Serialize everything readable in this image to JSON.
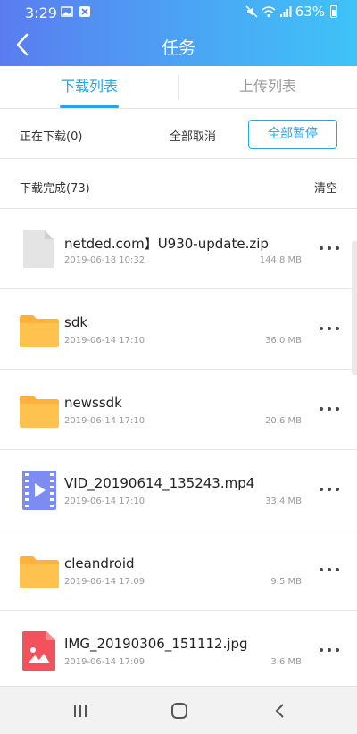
{
  "status_bar": {
    "time": "3:29",
    "battery": "63%"
  },
  "header": {
    "title": "任务"
  },
  "tabs": [
    {
      "label": "下载列表",
      "active": true
    },
    {
      "label": "上传列表",
      "active": false
    }
  ],
  "downloading": {
    "label": "正在下载(0)",
    "cancel_all": "全部取消",
    "pause_all": "全部暂停"
  },
  "completed": {
    "label": "下载完成(73)",
    "clear": "清空"
  },
  "files": [
    {
      "name": "netded.com】U930-update.zip",
      "date": "2019-06-18 10:32",
      "size": "144.8 MB",
      "icon": "zip-file-icon"
    },
    {
      "name": "sdk",
      "date": "2019-06-14 17:10",
      "size": "36.0 MB",
      "icon": "folder-icon"
    },
    {
      "name": "newssdk",
      "date": "2019-06-14 17:10",
      "size": "20.6 MB",
      "icon": "folder-icon"
    },
    {
      "name": "VID_20190614_135243.mp4",
      "date": "2019-06-14 17:10",
      "size": "33.4 MB",
      "icon": "video-file-icon"
    },
    {
      "name": "cleandroid",
      "date": "2019-06-14 17:09",
      "size": "9.5 MB",
      "icon": "folder-icon"
    },
    {
      "name": "IMG_20190306_151112.jpg",
      "date": "2019-06-14 17:09",
      "size": "3.6 MB",
      "icon": "image-file-icon"
    }
  ],
  "colors": {
    "accent": "#2aa3e6",
    "folder": "#ffb23b",
    "video": "#7c8cf0",
    "image": "#f2525b"
  }
}
